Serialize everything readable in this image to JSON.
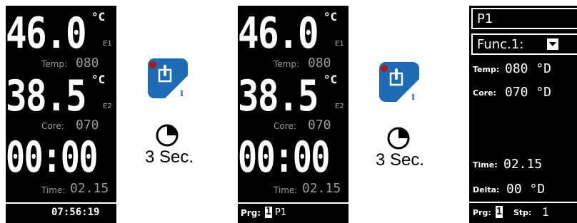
{
  "screen1": {
    "temp_value": "46.0",
    "temp_unit": "°C",
    "sensor1_code": "E1",
    "temp_label": "Temp:",
    "temp_setpoint": "080",
    "core_value": "38.5",
    "core_unit": "°C",
    "sensor2_code": "E2",
    "core_label": "Core:",
    "core_setpoint": "070",
    "timer_value": "00:00",
    "time_label": "Time:",
    "time_setpoint": "02.15",
    "clock": "07:56:19"
  },
  "transition1": {
    "icon": "probe-icon",
    "timer_icon": "timer-icon",
    "caption": "3 Sec."
  },
  "screen2": {
    "temp_value": "46.0",
    "temp_unit": "°C",
    "sensor1_code": "E1",
    "temp_label": "Temp:",
    "temp_setpoint": "080",
    "core_value": "38.5",
    "core_unit": "°C",
    "sensor2_code": "E2",
    "core_label": "Core:",
    "core_setpoint": "070",
    "timer_value": "00:00",
    "time_label": "Time:",
    "time_setpoint": "02.15",
    "prg_label": "Prg:",
    "prg_number": "1",
    "prg_name": "P1"
  },
  "transition2": {
    "icon": "probe-icon",
    "timer_icon": "timer-icon",
    "caption": "3 Sec."
  },
  "screen3": {
    "program_name": "P1",
    "function_label": "Func.1:",
    "temp_label": "Temp:",
    "temp_value": "080 °D",
    "core_label": "Core:",
    "core_value": "070 °D",
    "time_label": "Time:",
    "time_value": "02.15",
    "delta_label": "Delta:",
    "delta_value": "00 °D",
    "prg_label": "Prg:",
    "prg_number": "1",
    "stp_label": "Stp:",
    "stp_value": "1"
  },
  "colors": {
    "icon_blue": "#1e6bb5",
    "screen_bg": "#000000",
    "screen_fg": "#ffffff",
    "dim_text": "#9a9a9a"
  }
}
